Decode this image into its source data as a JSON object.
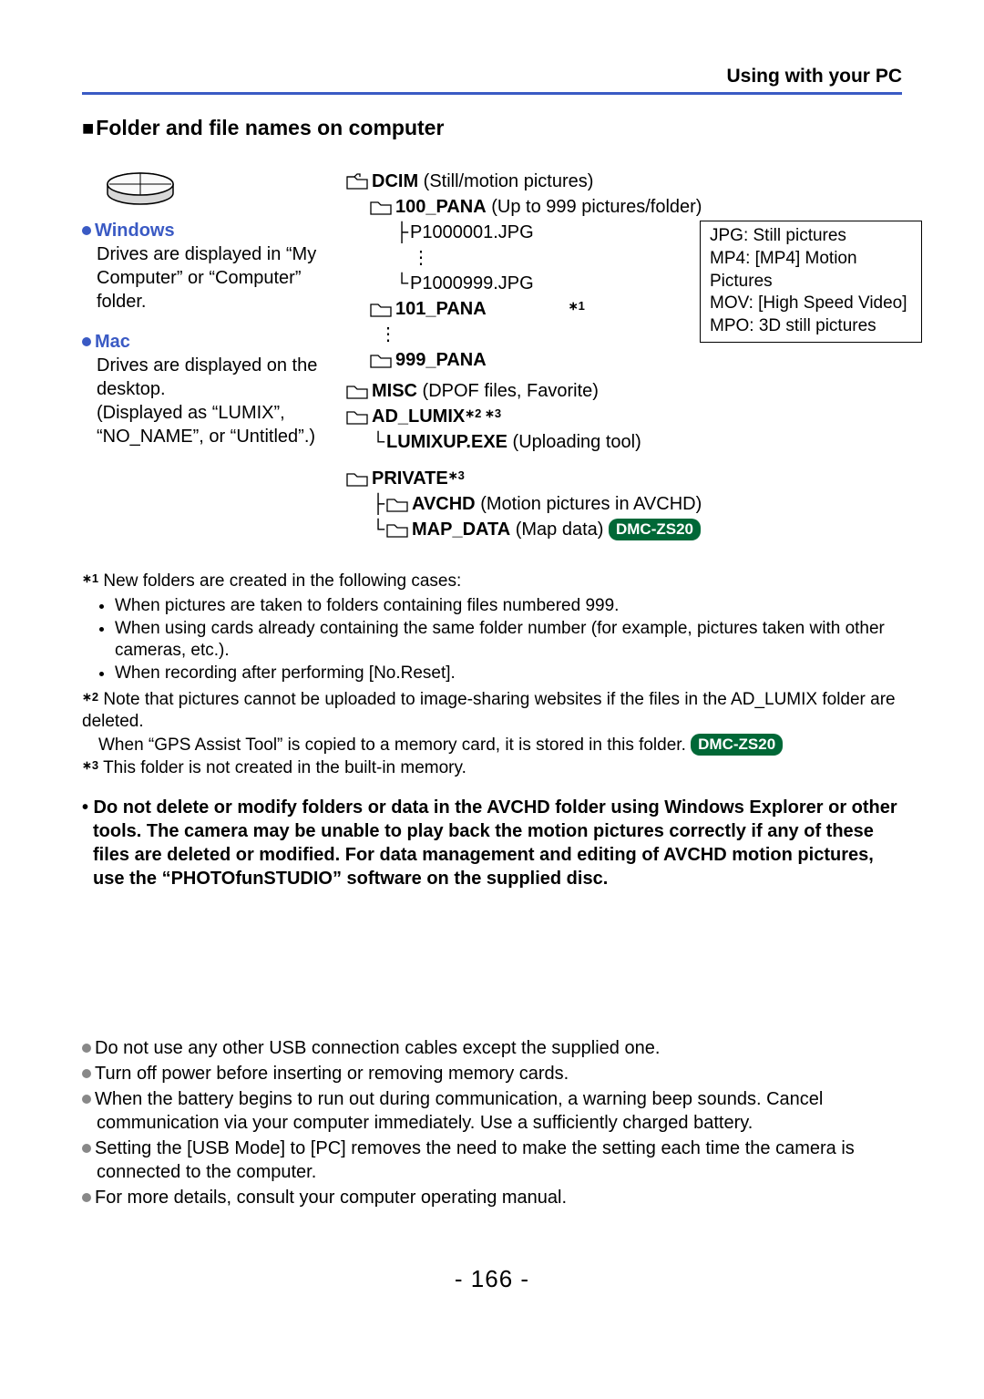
{
  "header": {
    "right": "Using with your PC"
  },
  "section_title": "Folder and file names on computer",
  "left": {
    "windows": {
      "label": "Windows",
      "desc": "Drives are displayed in “My Computer” or “Computer” folder."
    },
    "mac": {
      "label": "Mac",
      "desc": "Drives are displayed on the desktop.\n(Displayed as “LUMIX”, “NO_NAME”, or “Untitled”.)"
    }
  },
  "tree": {
    "dcim": {
      "bold": "DCIM",
      "rest": " (Still/motion pictures)"
    },
    "f100": {
      "bold": "100_PANA",
      "rest": " (Up to 999 pictures/folder)"
    },
    "file1": "P1000001.JPG",
    "filedots": "⋮",
    "file999": "P1000999.JPG",
    "f101": {
      "bold": "101_PANA"
    },
    "folderdots": "⋮",
    "f999": {
      "bold": "999_PANA"
    },
    "brace_note": "∗1",
    "misc": {
      "bold": "MISC",
      "rest": " (DPOF files, Favorite)"
    },
    "adlumix": {
      "bold": "AD_LUMIX",
      "sup": "∗2 ∗3"
    },
    "lumixup": {
      "bold": "LUMIXUP.EXE",
      "rest": " (Uploading tool)"
    },
    "private": {
      "bold": "PRIVATE",
      "sup": "∗3"
    },
    "avchd": {
      "bold": "AVCHD",
      "rest": " (Motion pictures in AVCHD)"
    },
    "mapdata": {
      "bold": "MAP_DATA",
      "rest": " (Map data) ",
      "badge": "DMC-ZS20"
    }
  },
  "callout": {
    "l1": "JPG: Still pictures",
    "l2": "MP4: [MP4] Motion Pictures",
    "l3": "MOV: [High Speed Video]",
    "l4": "MPO: 3D still pictures"
  },
  "footnotes": {
    "n1_intro": "New folders are created in the following cases:",
    "n1_b1": "When pictures are taken to folders containing files numbered 999.",
    "n1_b2": "When using cards already containing the same folder number (for example, pictures taken with other cameras, etc.).",
    "n1_b3": "When recording after performing [No.Reset].",
    "n2a": "Note that pictures cannot be uploaded to image-sharing websites if the files in the AD_LUMIX folder are deleted.",
    "n2b_pre": "When “GPS Assist Tool” is copied to a memory card, it is stored in this folder. ",
    "n2b_badge": "DMC-ZS20",
    "n3": "This folder is not created in the built-in memory."
  },
  "warning": "• Do not delete or modify folders or data in the AVCHD folder using Windows Explorer or other tools. The camera may be unable to play back the motion pictures correctly if any of these files are deleted or modified. For data management and editing of AVCHD motion pictures, use the “PHOTOfunSTUDIO” software on the supplied disc.",
  "bottom": {
    "b1": "Do not use any other USB connection cables except the supplied one.",
    "b2": "Turn off power before inserting or removing memory cards.",
    "b3": "When the battery begins to run out during communication, a warning beep sounds. Cancel communication via your computer immediately. Use a sufficiently charged battery.",
    "b4": "Setting the [USB Mode] to [PC] removes the need to make the setting each time the camera is connected to the computer.",
    "b5": "For more details, consult your computer operating manual."
  },
  "page_number": "- 166 -"
}
